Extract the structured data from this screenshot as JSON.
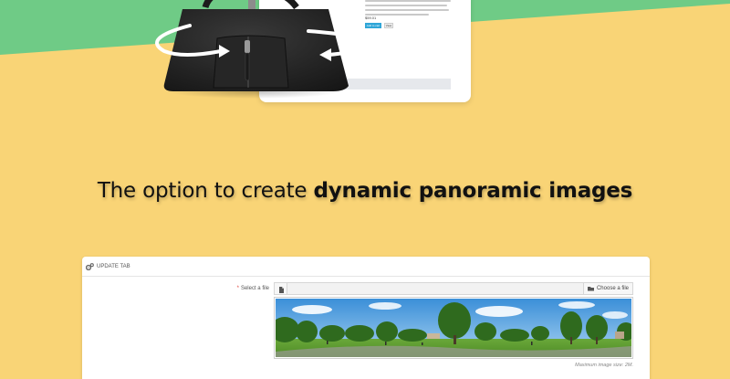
{
  "colors": {
    "background": "#f9d476",
    "accent_green": "#6fcb86",
    "panel": "#ffffff",
    "required": "#e0453d",
    "button_blue": "#2fa6d8"
  },
  "product_card": {
    "price": "$59.01",
    "add_button_label": "Add to cart",
    "view_button_label": "View"
  },
  "headline": {
    "regular": "The option to create ",
    "bold": "dynamic panoramic  images"
  },
  "panel": {
    "header_icon": "gears-icon",
    "title": "UPDATE TAB",
    "field": {
      "required_mark": "*",
      "label": "Select a file",
      "file_icon": "file-icon",
      "choose_icon": "folder-open-icon",
      "choose_label": "Choose a file"
    },
    "preview_image": "panoramic park landscape",
    "max_size_note": "Maximum image size: 2M."
  }
}
